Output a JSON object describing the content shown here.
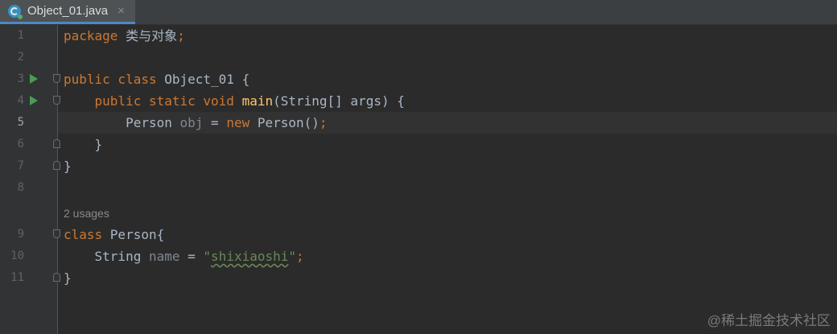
{
  "tab": {
    "file_name": "Object_01.java",
    "close_symbol": "×",
    "icon": "java-class-icon"
  },
  "code_lines": [
    {
      "num": "1",
      "parts": [
        {
          "t": "package ",
          "c": "kw"
        },
        {
          "t": "类与对象",
          "c": ""
        },
        {
          "t": ";",
          "c": "kw"
        }
      ]
    },
    {
      "num": "2",
      "parts": []
    },
    {
      "num": "3",
      "parts": [
        {
          "t": "public class ",
          "c": "kw"
        },
        {
          "t": "Object_01 {",
          "c": ""
        }
      ]
    },
    {
      "num": "4",
      "parts": [
        {
          "t": "    public static void ",
          "c": "kw"
        },
        {
          "t": "main",
          "c": "fn"
        },
        {
          "t": "(String[] args) {",
          "c": ""
        }
      ]
    },
    {
      "num": "5",
      "parts": [
        {
          "t": "        Person ",
          "c": ""
        },
        {
          "t": "obj",
          "c": "gray"
        },
        {
          "t": " = ",
          "c": ""
        },
        {
          "t": "new ",
          "c": "kw"
        },
        {
          "t": "Person()",
          "c": ""
        },
        {
          "t": ";",
          "c": "kw"
        }
      ]
    },
    {
      "num": "6",
      "parts": [
        {
          "t": "    }",
          "c": ""
        }
      ]
    },
    {
      "num": "7",
      "parts": [
        {
          "t": "}",
          "c": ""
        }
      ]
    },
    {
      "num": "8",
      "parts": []
    },
    {
      "num": "9",
      "parts": [
        {
          "t": "class ",
          "c": "kw"
        },
        {
          "t": "Person{",
          "c": ""
        }
      ]
    },
    {
      "num": "10",
      "parts": [
        {
          "t": "    String ",
          "c": ""
        },
        {
          "t": "name",
          "c": "gray"
        },
        {
          "t": " = ",
          "c": ""
        },
        {
          "t": "\"",
          "c": "str"
        },
        {
          "t": "shixiaoshi",
          "c": "str str-inner"
        },
        {
          "t": "\"",
          "c": "str"
        },
        {
          "t": ";",
          "c": "kw"
        }
      ]
    },
    {
      "num": "11",
      "parts": [
        {
          "t": "}",
          "c": ""
        }
      ]
    }
  ],
  "usages_hint": "2 usages",
  "watermark": "@稀土掘金技术社区",
  "colors": {
    "background": "#2b2b2b",
    "keyword": "#cc7832",
    "function": "#ffc66d",
    "string": "#6a8759",
    "text": "#a9b7c6",
    "run_icon": "#499c54"
  }
}
